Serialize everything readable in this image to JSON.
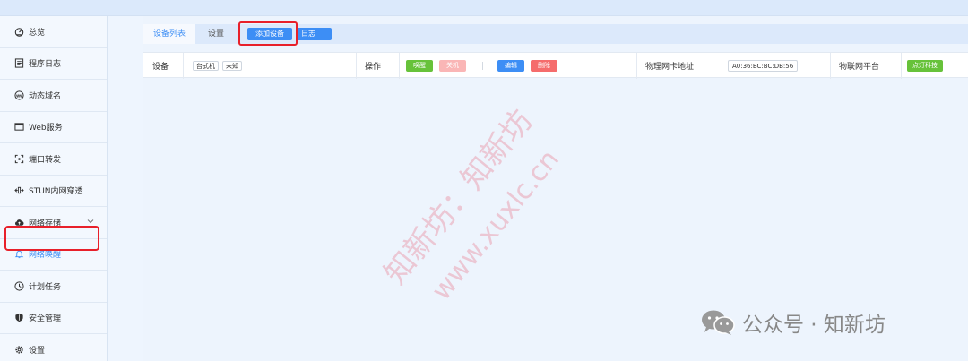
{
  "sidebar": {
    "items": [
      {
        "label": "总览",
        "icon": "dashboard-icon"
      },
      {
        "label": "程序日志",
        "icon": "log-icon"
      },
      {
        "label": "动态域名",
        "icon": "www-icon"
      },
      {
        "label": "Web服务",
        "icon": "browser-icon"
      },
      {
        "label": "端口转发",
        "icon": "port-forward-icon"
      },
      {
        "label": "STUN内网穿透",
        "icon": "stun-icon"
      },
      {
        "label": "网络存储",
        "icon": "cloud-icon"
      },
      {
        "label": "网络唤醒",
        "icon": "bell-icon"
      },
      {
        "label": "计划任务",
        "icon": "clock-icon"
      },
      {
        "label": "安全管理",
        "icon": "shield-icon"
      },
      {
        "label": "设置",
        "icon": "gear-icon"
      }
    ],
    "active_index": 7
  },
  "tabs": {
    "devices": "设备列表",
    "settings": "设置",
    "add_device": "添加设备",
    "log": "日志"
  },
  "device_row": {
    "device_label": "设备",
    "device_tags": [
      "台式机",
      "未知"
    ],
    "ops_label": "操作",
    "wake_btn": "唤醒",
    "shutdown_btn": "关机",
    "edit_btn": "编辑",
    "delete_btn": "删除",
    "mac_label": "物理网卡地址",
    "mac_value": "A0:36:BC:BC:DB:56",
    "iot_label": "物联网平台",
    "iot_value": "点灯科技"
  },
  "watermark": {
    "line1": "知新坊：知新坊",
    "line2": "www.xuxlc.cn"
  },
  "brand": {
    "text": "公众号 · 知新坊"
  },
  "colors": {
    "primary": "#3d8ef5",
    "success": "#67c23a",
    "danger": "#f56c6c",
    "danger_light": "#fab6b6",
    "highlight": "#e8202a"
  }
}
